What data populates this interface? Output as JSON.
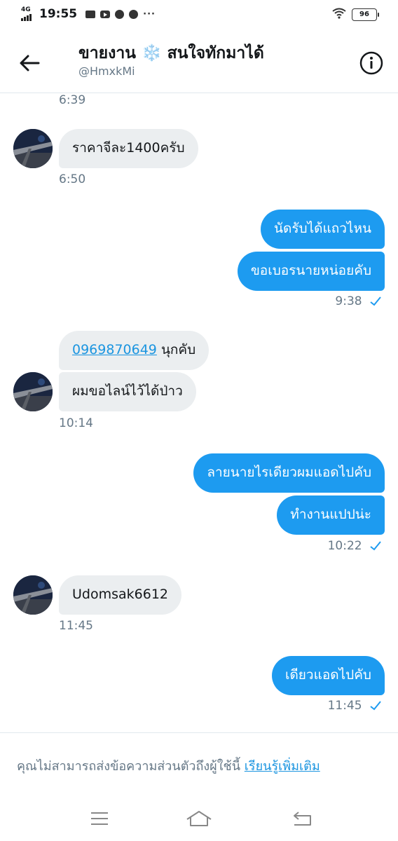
{
  "status_bar": {
    "network": "4G",
    "time": "19:55",
    "more": "···",
    "battery": "96"
  },
  "header": {
    "title_part1": "ขายงาน",
    "title_emoji": "❄️",
    "title_part2": "สนใจทักมาได้",
    "handle": "@HmxkMi"
  },
  "messages": {
    "t1": "6:39",
    "m1": "ราคาจีละ1400ครับ",
    "t2": "6:50",
    "m2": "นัดรับได้แถวไหน",
    "m3": "ขอเบอรนายหน่อยคับ",
    "t3": "9:38",
    "m4_link": "0969870649",
    "m4_rest": "นุกคับ",
    "m5": "ผมขอไลน์ไว้ได้ป่าว",
    "t4": "10:14",
    "m6": "ลายนายไรเดียวผมแอดไปคับ",
    "m7": "ทำงานแปปน่ะ",
    "t5": "10:22",
    "m8": "Udomsak6612",
    "t6": "11:45",
    "m9": "เดียวแอดไปคับ",
    "t7": "11:45"
  },
  "footer": {
    "notice": "คุณไม่สามารถส่งข้อความส่วนตัวถึงผู้ใช้นี้",
    "learn_more": "เรียนรู้เพิ่มเติม"
  },
  "colors": {
    "accent": "#1d9bf0",
    "incoming_bubble": "#ebeef0",
    "muted_text": "#657786"
  }
}
